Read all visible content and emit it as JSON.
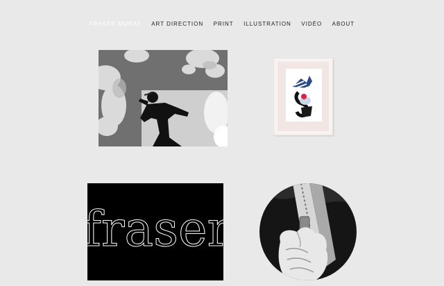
{
  "nav": {
    "items": [
      {
        "label": "FRASER MURAY",
        "active": true
      },
      {
        "label": "ART DIRECTION",
        "active": false
      },
      {
        "label": "PRINT",
        "active": false
      },
      {
        "label": "ILLUSTRATION",
        "active": false
      },
      {
        "label": "VIDÉO",
        "active": false
      },
      {
        "label": "ABOUT",
        "active": false
      }
    ]
  },
  "projects": {
    "fraser_wordmark": "fraser"
  },
  "colors": {
    "background": "#e9e9e9",
    "nav_text": "#222222",
    "nav_active": "#ffffff"
  }
}
